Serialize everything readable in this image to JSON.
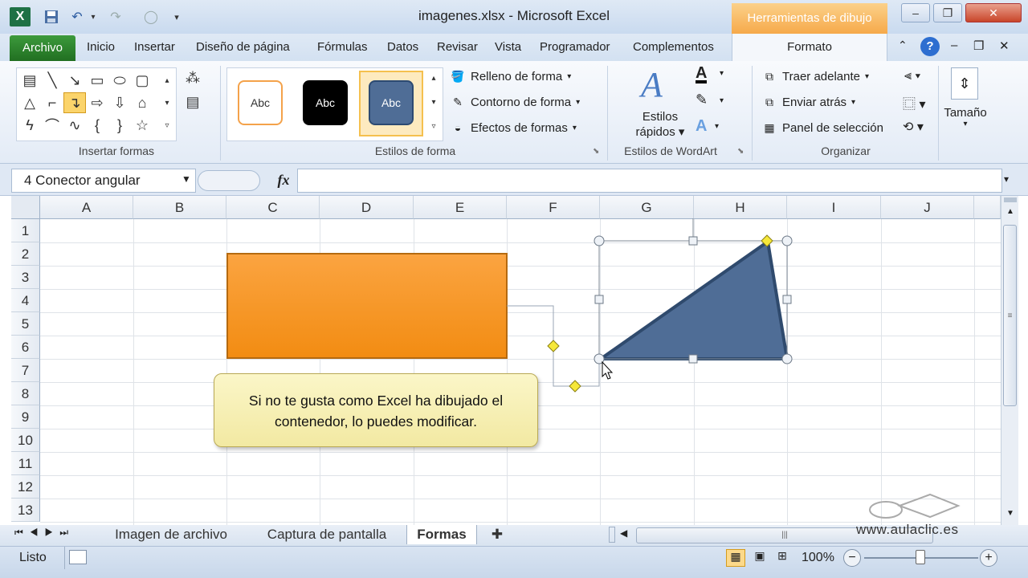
{
  "window": {
    "title": "imagenes.xlsx  -  Microsoft Excel",
    "tool_context": "Herramientas de dibujo"
  },
  "tabs": {
    "archivo": "Archivo",
    "items": [
      "Inicio",
      "Insertar",
      "Diseño de página",
      "Fórmulas",
      "Datos",
      "Revisar",
      "Vista",
      "Programador",
      "Complementos"
    ],
    "formato": "Formato"
  },
  "ribbon": {
    "insert_shapes_label": "Insertar formas",
    "shape_styles_label": "Estilos de forma",
    "style_samples": [
      "Abc",
      "Abc",
      "Abc"
    ],
    "relleno": "Relleno de forma",
    "contorno": "Contorno de forma",
    "efectos": "Efectos de formas",
    "estilos_rapidos_1": "Estilos",
    "estilos_rapidos_2": "rápidos",
    "wordart_label": "Estilos de WordArt",
    "traer": "Traer adelante",
    "enviar": "Enviar atrás",
    "panel": "Panel de selección",
    "organizar_label": "Organizar",
    "tamano": "Tamaño"
  },
  "formula_bar": {
    "name_box": "4 Conector angular",
    "fx": "fx",
    "value": ""
  },
  "columns": [
    "A",
    "B",
    "C",
    "D",
    "E",
    "F",
    "G",
    "H",
    "I",
    "J"
  ],
  "rows": [
    "1",
    "2",
    "3",
    "4",
    "5",
    "6",
    "7",
    "8",
    "9",
    "10",
    "11",
    "12",
    "13"
  ],
  "callout": {
    "line1": "Si no te gusta como Excel ha dibujado el",
    "line2": "contenedor, lo puedes modificar."
  },
  "sheets": {
    "tabs": [
      "Imagen de archivo",
      "Captura de pantalla",
      "Formas"
    ],
    "active": "Formas"
  },
  "status": {
    "ready": "Listo",
    "zoom": "100%"
  },
  "watermark": "www.aulaclic.es",
  "colors": {
    "orange": "#f7931e",
    "triangle": "#4f6d96",
    "excel_green": "#217346"
  }
}
